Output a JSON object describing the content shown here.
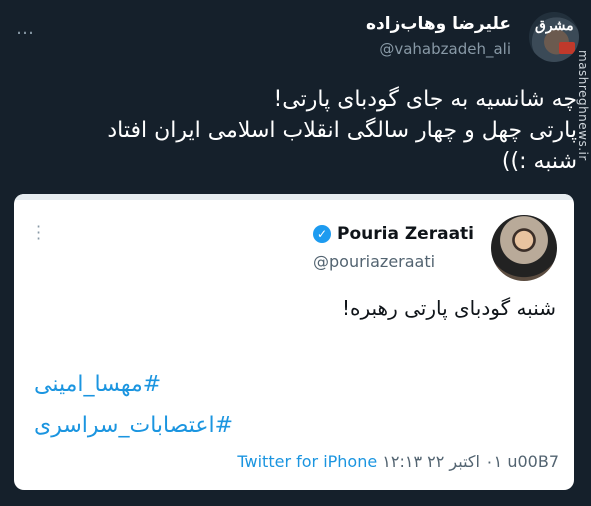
{
  "tweet": {
    "more_icon": "…",
    "author_name": "علیرضا وهاب‌زاده",
    "author_handle": "@vahabzadeh_ali",
    "lines": [
      "چه شانسیه به جای گودبای پارتی!",
      "پارتی چهل و چهار سالگی انقلاب اسلامی ایران افتاد",
      "شنبه :))"
    ]
  },
  "watermark": "mashreghnews.ir",
  "avatar_logo": "مشرق",
  "quote": {
    "author_name": "Pouria Zeraati",
    "author_handle": "@pouriazeraati",
    "text": "شنبه گودبای پارتی رهبره!",
    "hashtags": [
      "#مهسا_امینی",
      "#اعتصابات_سراسری"
    ],
    "timestamp": "۱۲:۱۳ ‏۰۱ ‏اکتبر ۲۲ u00B7 ",
    "source": "Twitter for iPhone"
  }
}
